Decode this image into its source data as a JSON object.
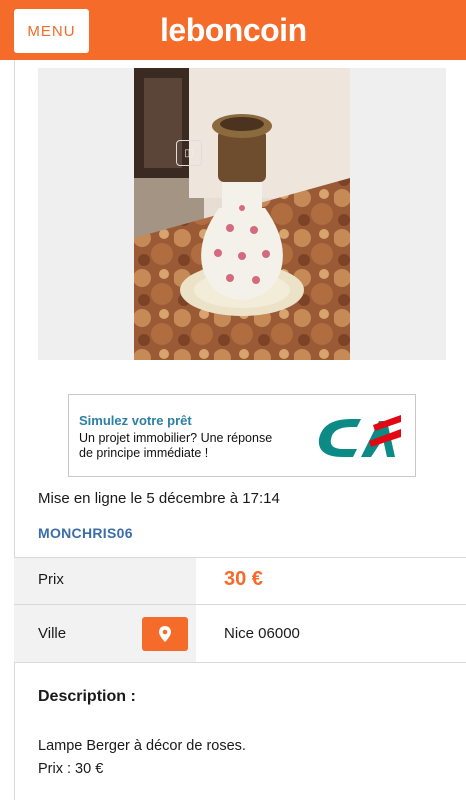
{
  "header": {
    "menu_label": "MENU",
    "logo_text": "leboncoin",
    "brand_color": "#f56b2a"
  },
  "listing": {
    "photo_icon": "3d-cube-icon",
    "posted": "Mise en ligne le 5 décembre à 17:14",
    "seller": "MONCHRIS06",
    "price_label": "Prix",
    "price_value": "30 €",
    "city_label": "Ville",
    "city_value": "Nice 06000",
    "map_icon": "location-pin-icon",
    "description_title": "Description :",
    "description_lines": [
      "Lampe Berger à décor de roses.",
      "Prix : 30 €"
    ]
  },
  "ad": {
    "title": "Simulez votre prêt",
    "line1": "Un projet immobilier? Une réponse",
    "line2": "de principe immédiate !",
    "logo": "credit-agricole-logo",
    "logo_colors": [
      "#0b8a86",
      "#e30613"
    ]
  }
}
